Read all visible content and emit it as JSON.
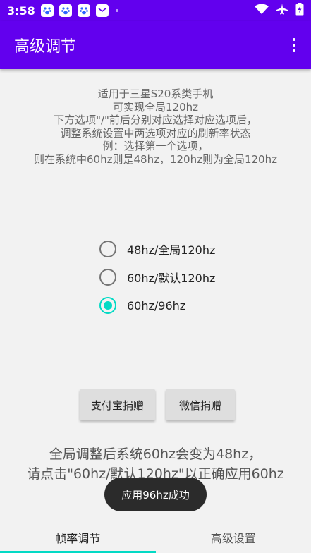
{
  "status_bar": {
    "time": "3:58",
    "notification_icons": [
      "paw-icon",
      "paw-icon",
      "paw-icon",
      "mail-icon"
    ],
    "right_icons": [
      "wifi-icon",
      "airplane-icon",
      "battery-icon"
    ]
  },
  "app_bar": {
    "title": "高级调节",
    "overflow_icon": "more-vert-icon"
  },
  "description": {
    "lines": [
      "适用于三星S20系类手机",
      "可实现全局120hz",
      "下方选项\"/\"前后分别对应选择对应选项后，",
      "调整系统设置中两选项对应的刷新率状态",
      "例：选择第一个选项，",
      "则在系统中60hz则是48hz，120hz则为全局120hz"
    ]
  },
  "options": [
    {
      "label": "48hz/全局120hz",
      "checked": false
    },
    {
      "label": "60hz/默认120hz",
      "checked": false
    },
    {
      "label": "60hz/96hz",
      "checked": true
    }
  ],
  "buttons": {
    "alipay": "支付宝捐赠",
    "wechat": "微信捐赠"
  },
  "bottom_text": {
    "line1": "全局调整后系统60hz会变为48hz，",
    "line2": "请点击\"60hz/默认120hz\"以正确应用60hz"
  },
  "toast": "应用96hz成功",
  "bottom_nav": {
    "tabs": [
      "帧率调节",
      "高级设置"
    ],
    "active_index": 0
  },
  "colors": {
    "primary": "#6200ee",
    "accent": "#03dac5"
  }
}
